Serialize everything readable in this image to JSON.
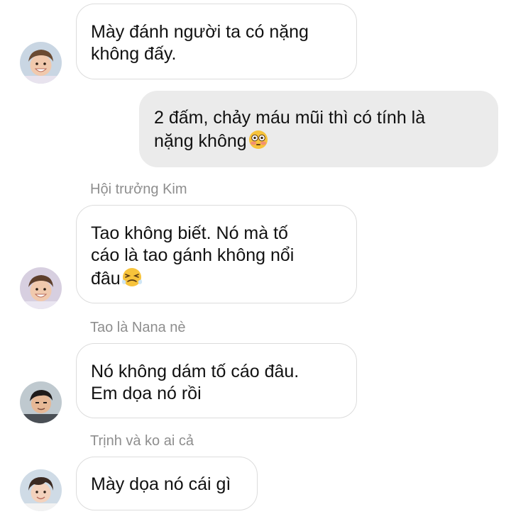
{
  "messages": [
    {
      "direction": "incoming",
      "sender": "",
      "lines": [
        "Mày đánh người ta có nặng",
        "không đấy."
      ],
      "avatar": "avatar-kim"
    },
    {
      "direction": "outgoing",
      "lines": [
        "2 đấm, chảy máu mũi thì có tính là",
        "nặng không"
      ],
      "emoji": "flushed-face-icon"
    },
    {
      "direction": "incoming",
      "sender": "Hội trưởng Kim",
      "lines": [
        "Tao không biết. Nó mà tố",
        "cáo là tao gánh không nổi",
        "đâu"
      ],
      "emoji": "persevering-face-icon",
      "avatar": "avatar-kim"
    },
    {
      "direction": "incoming",
      "sender": "Tao là Nana nè",
      "lines": [
        "Nó không dám tố cáo đâu.",
        "Em dọa nó rồi"
      ],
      "avatar": "avatar-nana"
    },
    {
      "direction": "incoming",
      "sender": "Trịnh và ko ai cả",
      "lines": [
        "Mày dọa nó cái gì"
      ],
      "avatar": "avatar-trinh"
    }
  ],
  "colors": {
    "incoming_bubble": "#ffffff",
    "incoming_border": "#dcdcdc",
    "outgoing_bubble": "#ebebeb",
    "sender_name": "#8e8e8e",
    "text": "#111111"
  }
}
